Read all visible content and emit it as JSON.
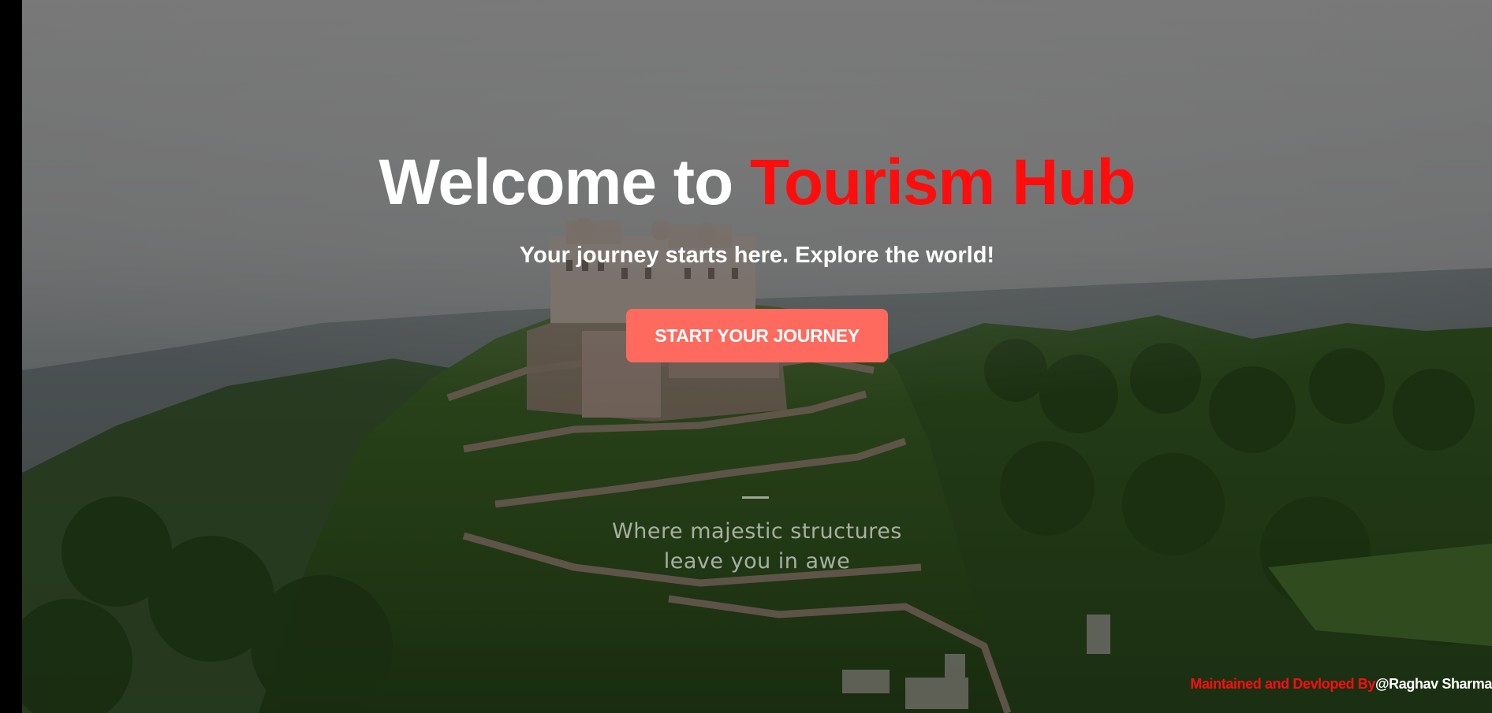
{
  "hero": {
    "title_prefix": "Welcome to",
    "title_brand": "Tourism Hub",
    "subtitle": "Your journey starts here. Explore the world!",
    "cta_label": "START YOUR JOURNEY",
    "tagline_line1": "Where majestic structures",
    "tagline_line2": "leave you in awe",
    "background_image": "hilltop-fort-landscape"
  },
  "footer": {
    "credit_prefix": "Maintained and Devloped By",
    "credit_name": "@Raghav Sharma"
  },
  "colors": {
    "brand_red": "#ff0d0d",
    "cta_background": "#ff6a5e",
    "text": "#ffffff"
  }
}
